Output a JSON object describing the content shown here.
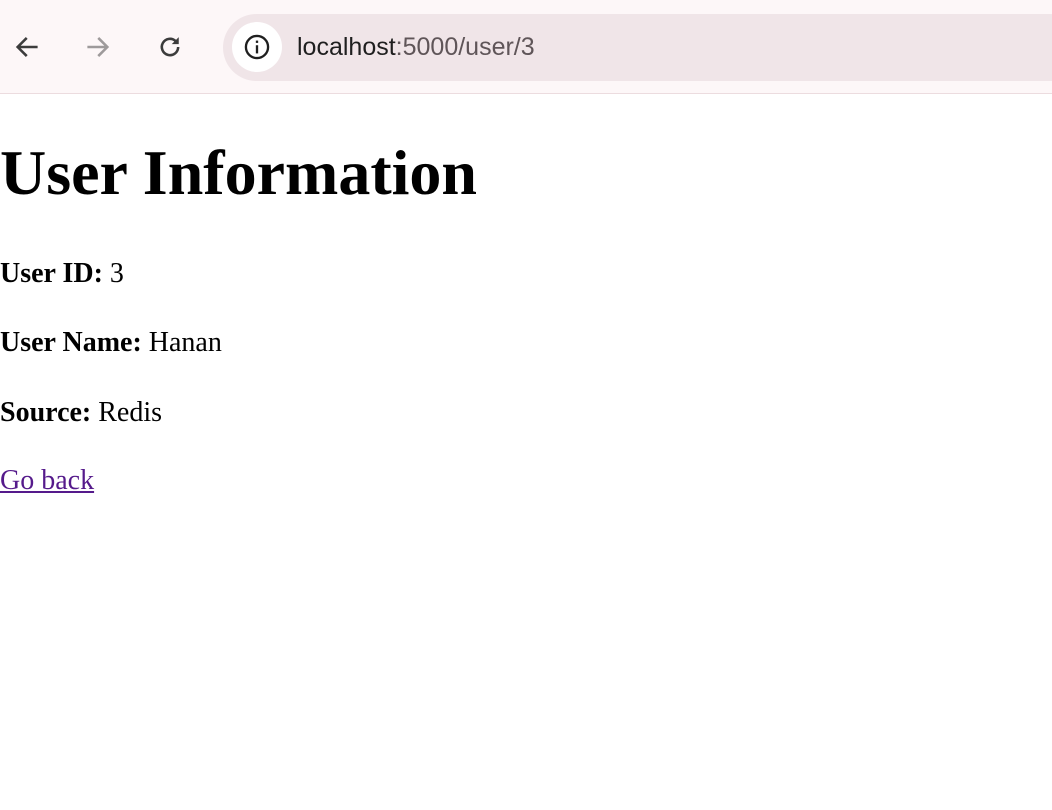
{
  "browser": {
    "back_icon": "arrow-left-icon",
    "forward_icon": "arrow-right-icon",
    "reload_icon": "reload-icon",
    "site_info_icon": "info-icon",
    "url_host": "localhost",
    "url_path": ":5000/user/3",
    "colors": {
      "toolbar_bg": "#fdf7f8",
      "omnibox_bg": "#f0e5e8",
      "icon_active": "#3c3c3c",
      "icon_disabled": "#9e9a9b"
    }
  },
  "page": {
    "title": "User Information",
    "fields": [
      {
        "label": "User ID:",
        "value": "3"
      },
      {
        "label": "User Name:",
        "value": "Hanan"
      },
      {
        "label": "Source:",
        "value": "Redis"
      }
    ],
    "back_link": "Go back",
    "link_color": "#551a8b"
  }
}
